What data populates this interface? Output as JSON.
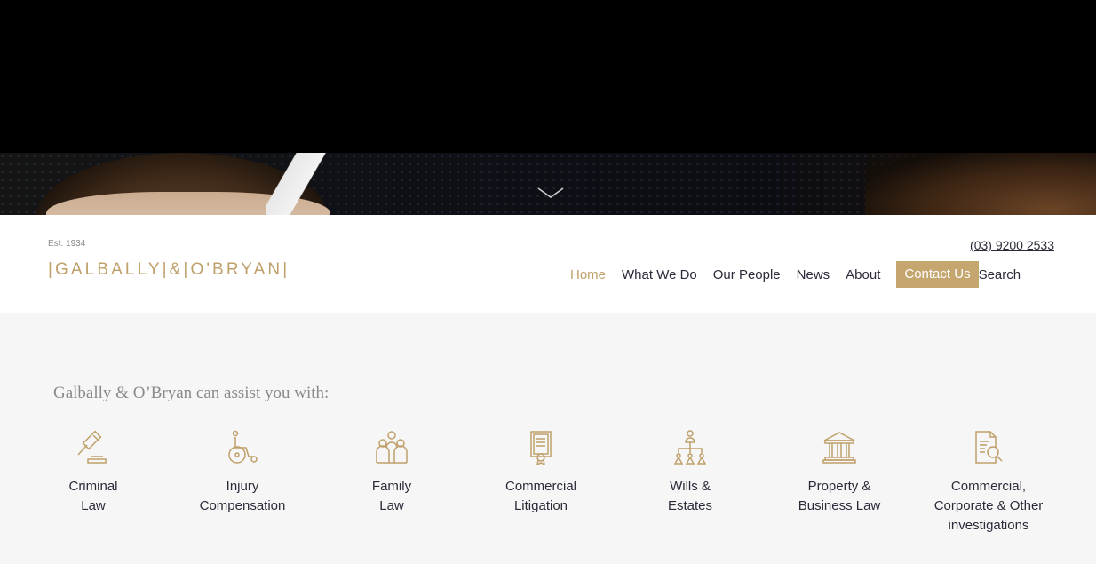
{
  "header": {
    "established": "Est. 1934",
    "logo_text": "|GALBALLY|&|O'BRYAN|",
    "phone": "(03) 9200 2533"
  },
  "nav": {
    "items": [
      {
        "label": "Home",
        "active": true
      },
      {
        "label": "What We Do"
      },
      {
        "label": "Our People"
      },
      {
        "label": "News"
      },
      {
        "label": "About"
      }
    ],
    "contact_label": "Contact Us",
    "search_label": "Search"
  },
  "services": {
    "intro": "Galbally & O’Bryan can assist you with:",
    "items": [
      {
        "label": "Criminal\nLaw",
        "icon": "gavel-icon"
      },
      {
        "label": "Injury\nCompensation",
        "icon": "wheelchair-icon"
      },
      {
        "label": "Family\nLaw",
        "icon": "family-icon"
      },
      {
        "label": "Commercial\nLitigation",
        "icon": "certificate-icon"
      },
      {
        "label": "Wills &\nEstates",
        "icon": "family-tree-icon"
      },
      {
        "label": "Property &\nBusiness Law",
        "icon": "building-icon"
      },
      {
        "label": "Commercial,\nCorporate & Other\ninvestigations",
        "icon": "document-search-icon"
      }
    ]
  },
  "colors": {
    "accent": "#c4a66e",
    "text": "#2b2b3a",
    "background": "#f6f6f6"
  }
}
